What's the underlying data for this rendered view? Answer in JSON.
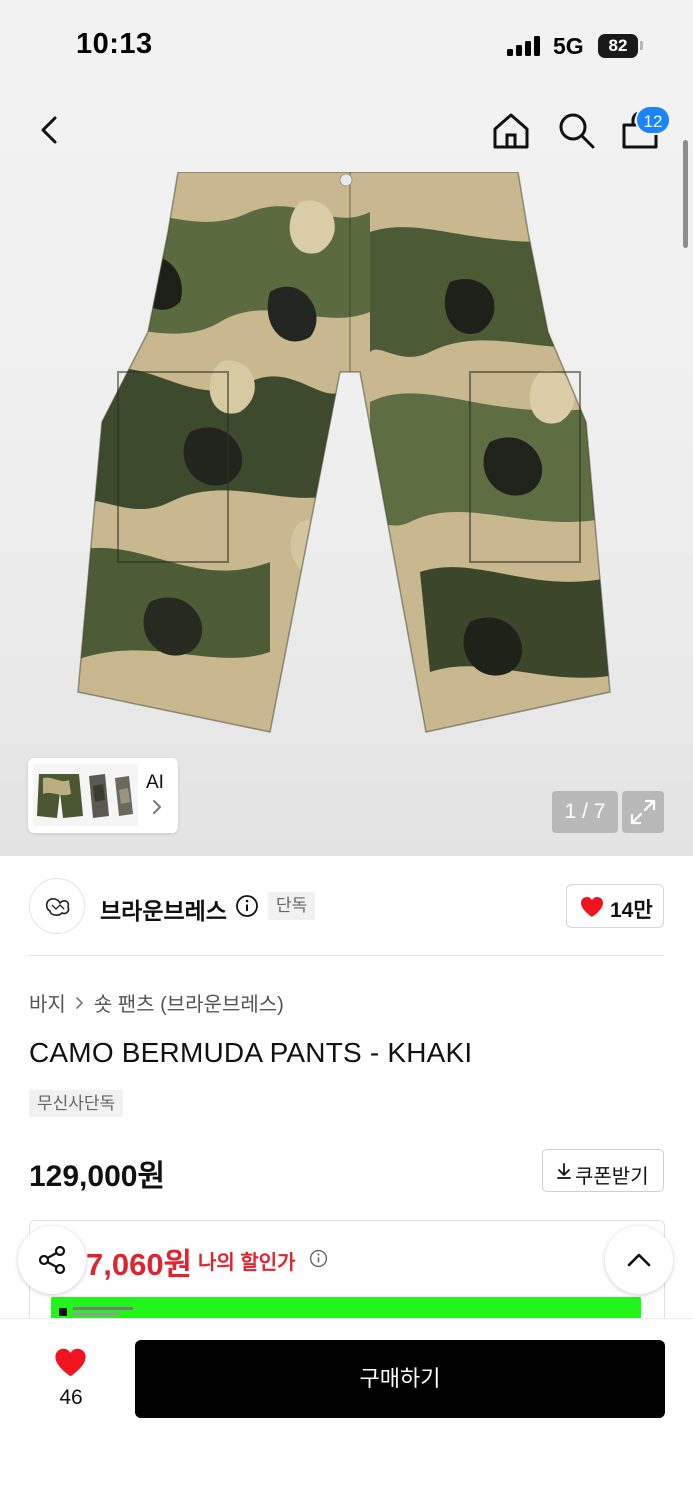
{
  "status_bar": {
    "time": "10:13",
    "network": "5G",
    "battery": "82"
  },
  "nav": {
    "back_icon": "chevron-left-icon",
    "home_icon": "home-icon",
    "search_icon": "search-icon",
    "cart_icon": "shopping-bag-icon",
    "cart_count": "12"
  },
  "gallery": {
    "thumb_label": "AI",
    "page_indicator": "1 / 7",
    "expand_icon": "expand-icon"
  },
  "brand": {
    "name": "브라운브레스",
    "exclusive_badge": "단독",
    "likes": "14만",
    "info_icon": "info-icon",
    "heart_icon": "heart-icon"
  },
  "product": {
    "breadcrumb": [
      "바지",
      "숏 팬츠 (브라운브레스)"
    ],
    "title": "CAMO BERMUDA PANTS - KHAKI",
    "tag": "무신사단독",
    "price": "129,000원",
    "coupon_label": "쿠폰받기"
  },
  "discount": {
    "my_price": "7,060원",
    "my_price_label": "나의 할인가"
  },
  "actions": {
    "wish_count": "46",
    "buy_label": "구매하기",
    "share_icon": "share-icon",
    "scroll_top_icon": "chevron-up-icon"
  },
  "colors": {
    "accent_red": "#e0232e",
    "badge_blue": "#1a84ff",
    "banner_green": "#22f51c",
    "buy_button": "#000000"
  }
}
